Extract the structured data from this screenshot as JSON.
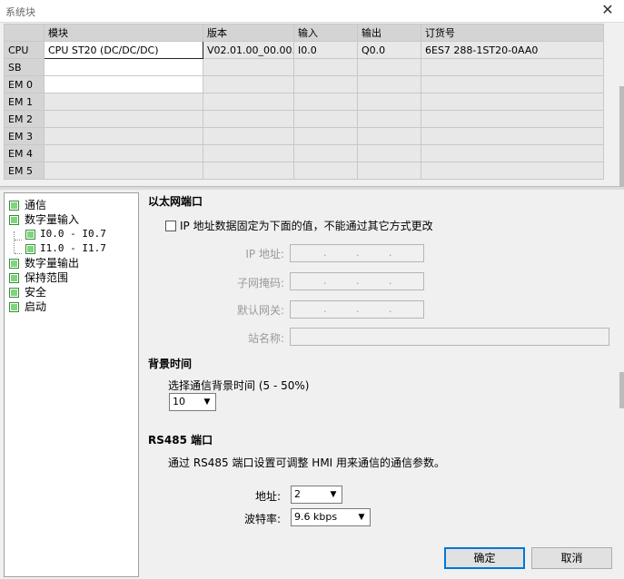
{
  "window": {
    "title": "系统块",
    "close_glyph": "✕"
  },
  "table": {
    "headers": [
      "模块",
      "版本",
      "输入",
      "输出",
      "订货号"
    ],
    "rows": [
      {
        "slot": "CPU",
        "module": "CPU ST20 (DC/DC/DC)",
        "version": "V02.01.00_00.00...",
        "input": "I0.0",
        "output": "Q0.0",
        "order": "6ES7 288-1ST20-0AA0"
      },
      {
        "slot": "SB",
        "module": "",
        "version": "",
        "input": "",
        "output": "",
        "order": ""
      },
      {
        "slot": "EM 0",
        "module": "",
        "version": "",
        "input": "",
        "output": "",
        "order": ""
      },
      {
        "slot": "EM 1",
        "module": "",
        "version": "",
        "input": "",
        "output": "",
        "order": ""
      },
      {
        "slot": "EM 2",
        "module": "",
        "version": "",
        "input": "",
        "output": "",
        "order": ""
      },
      {
        "slot": "EM 3",
        "module": "",
        "version": "",
        "input": "",
        "output": "",
        "order": ""
      },
      {
        "slot": "EM 4",
        "module": "",
        "version": "",
        "input": "",
        "output": "",
        "order": ""
      },
      {
        "slot": "EM 5",
        "module": "",
        "version": "",
        "input": "",
        "output": "",
        "order": ""
      }
    ]
  },
  "tree": {
    "items": [
      "通信",
      "数字量输入",
      "I0.0 - I0.7",
      "I1.0 - I1.7",
      "数字量输出",
      "保持范围",
      "安全",
      "启动"
    ]
  },
  "ethernet": {
    "heading": "以太网端口",
    "fixed_ip_label": "IP 地址数据固定为下面的值，不能通过其它方式更改",
    "fixed_ip_checked": false,
    "ip_label": "IP 地址:",
    "mask_label": "子网掩码:",
    "gateway_label": "默认网关:",
    "station_label": "站名称:",
    "dot": "."
  },
  "background": {
    "heading": "背景时间",
    "desc": "选择通信背景时间 (5 - 50%)",
    "value": "10"
  },
  "rs485": {
    "heading": "RS485 端口",
    "desc": "通过 RS485 端口设置可调整 HMI 用来通信的通信参数。",
    "address_label": "地址:",
    "address_value": "2",
    "baud_label": "波特率:",
    "baud_value": "9.6 kbps"
  },
  "buttons": {
    "ok": "确定",
    "cancel": "取消"
  },
  "icons": {
    "combo_arrow": "▼"
  }
}
